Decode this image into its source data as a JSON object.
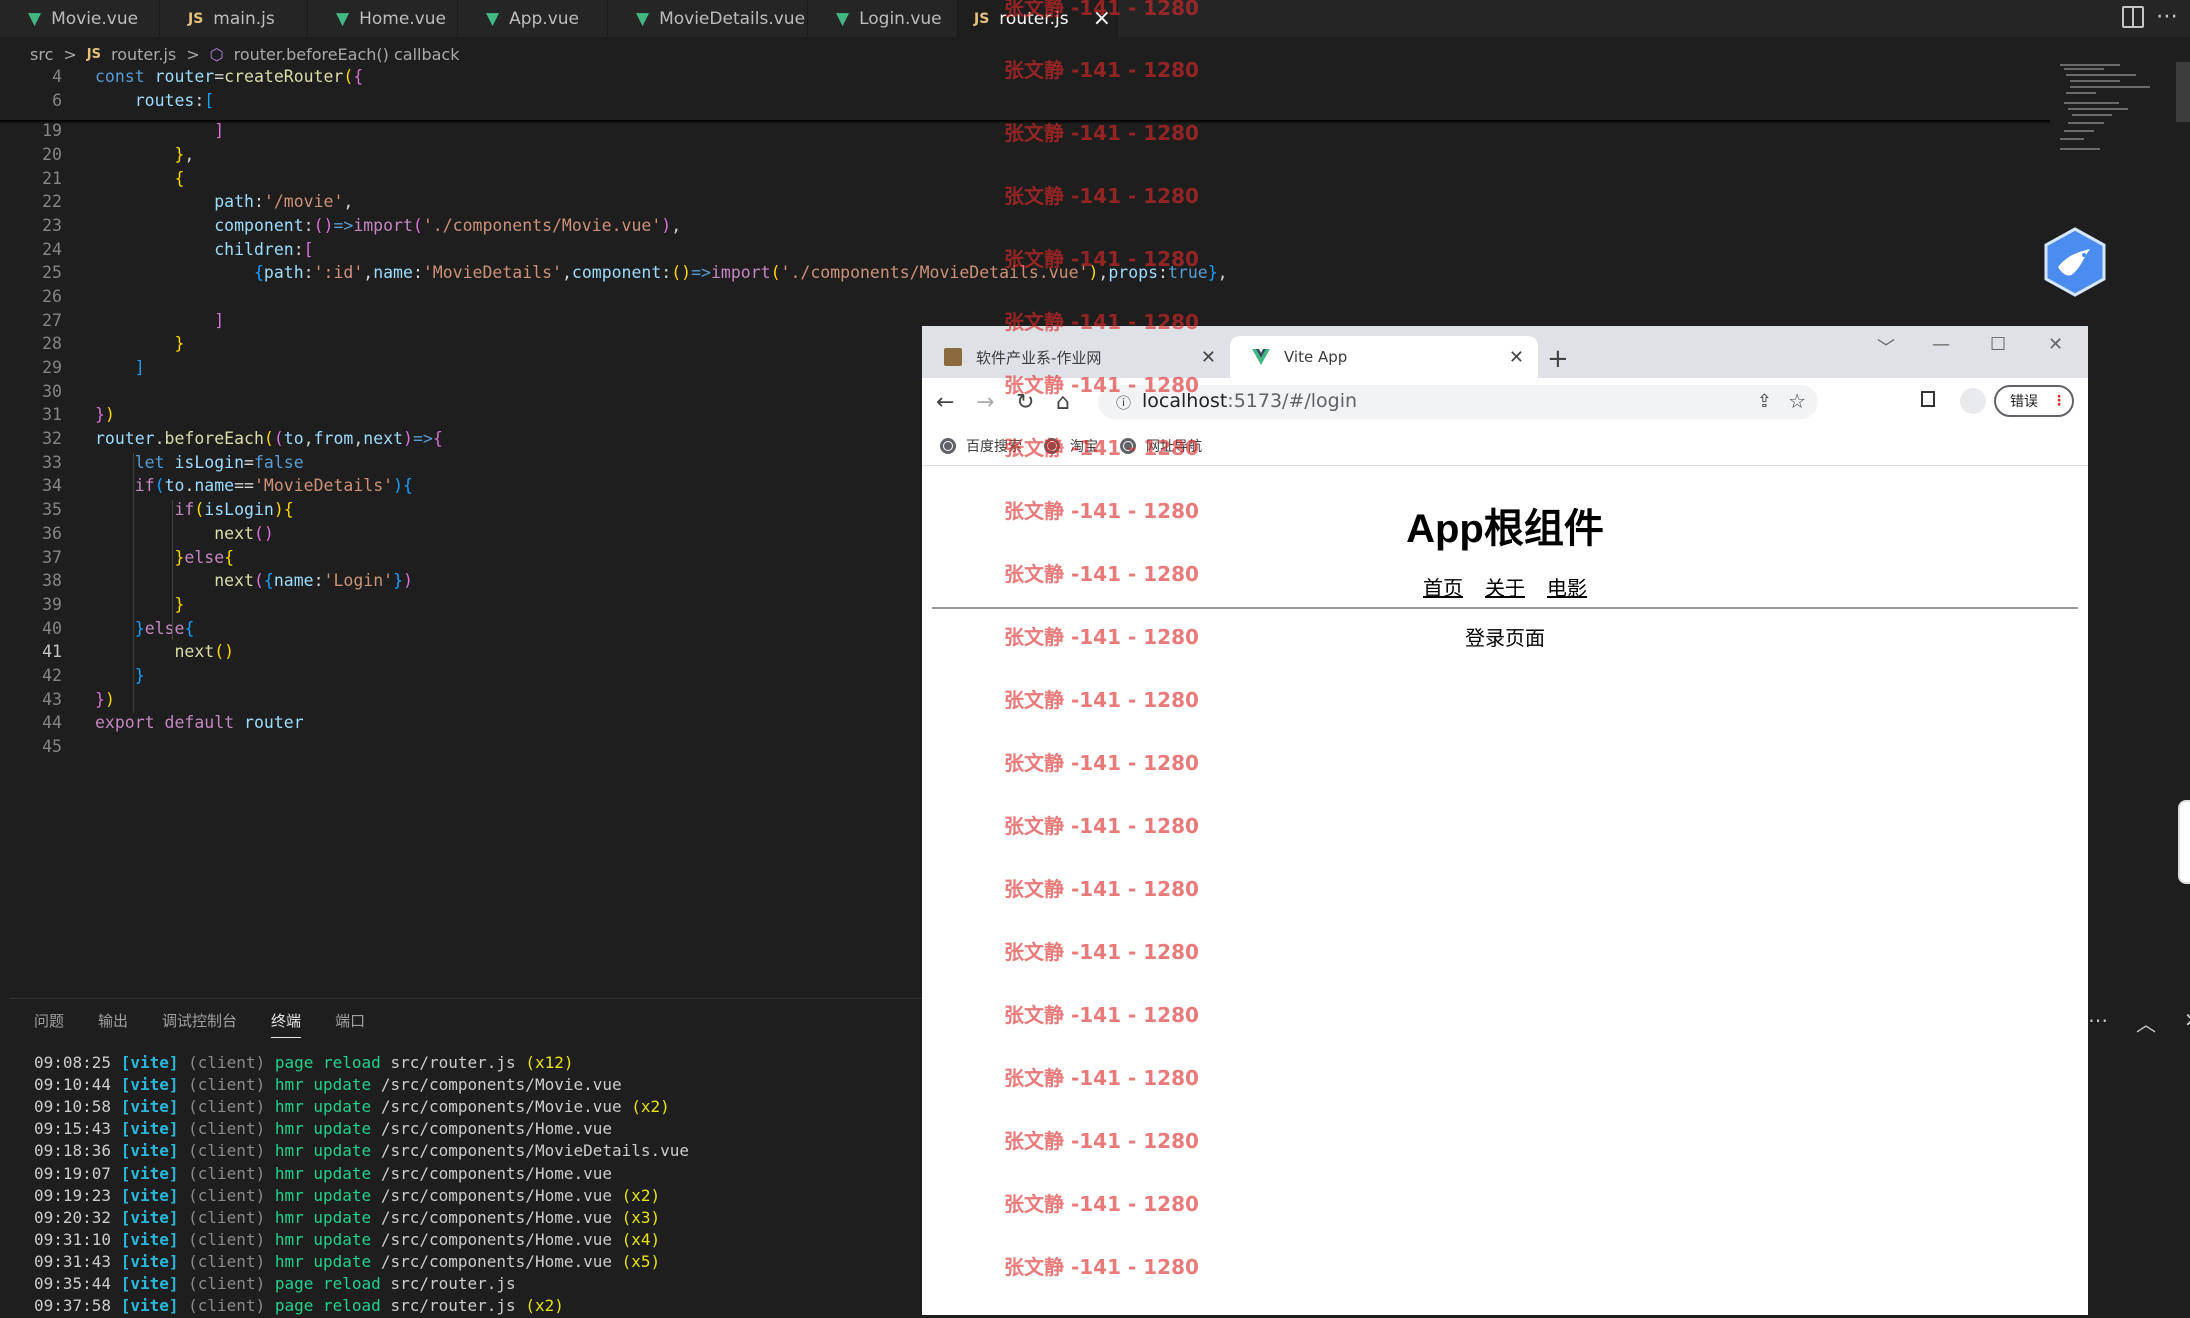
{
  "editor": {
    "tabs": [
      {
        "label": "Movie.vue",
        "type": "vue"
      },
      {
        "label": "main.js",
        "type": "js"
      },
      {
        "label": "Home.vue",
        "type": "vue"
      },
      {
        "label": "App.vue",
        "type": "vue"
      },
      {
        "label": "MovieDetails.vue",
        "type": "vue"
      },
      {
        "label": "Login.vue",
        "type": "vue"
      },
      {
        "label": "router.js",
        "type": "js",
        "active": true
      }
    ],
    "js_badge": "JS",
    "close_glyph": "×",
    "breadcrumb": {
      "folder": "src",
      "sep": ">",
      "file": "router.js",
      "symbol": "router.beforeEach() callback"
    },
    "line_numbers": [
      "4",
      "6",
      "19",
      "20",
      "21",
      "22",
      "23",
      "24",
      "25",
      "26",
      "27",
      "28",
      "29",
      "30",
      "31",
      "32",
      "33",
      "34",
      "35",
      "36",
      "37",
      "38",
      "39",
      "40",
      "41",
      "42",
      "43",
      "44",
      "45"
    ]
  },
  "panel": {
    "tabs": [
      "问题",
      "输出",
      "调试控制台",
      "终端",
      "端口"
    ],
    "active_tab": "终端",
    "terminal": [
      {
        "time": "09:08:25",
        "tag": "[vite]",
        "src": "(client)",
        "action": "page reload",
        "path": "src/router.js",
        "count": "(x12)"
      },
      {
        "time": "09:10:44",
        "tag": "[vite]",
        "src": "(client)",
        "action": "hmr update",
        "path": "/src/components/Movie.vue",
        "count": ""
      },
      {
        "time": "09:10:58",
        "tag": "[vite]",
        "src": "(client)",
        "action": "hmr update",
        "path": "/src/components/Movie.vue",
        "count": "(x2)"
      },
      {
        "time": "09:15:43",
        "tag": "[vite]",
        "src": "(client)",
        "action": "hmr update",
        "path": "/src/components/Home.vue",
        "count": ""
      },
      {
        "time": "09:18:36",
        "tag": "[vite]",
        "src": "(client)",
        "action": "hmr update",
        "path": "/src/components/MovieDetails.vue",
        "count": ""
      },
      {
        "time": "09:19:07",
        "tag": "[vite]",
        "src": "(client)",
        "action": "hmr update",
        "path": "/src/components/Home.vue",
        "count": ""
      },
      {
        "time": "09:19:23",
        "tag": "[vite]",
        "src": "(client)",
        "action": "hmr update",
        "path": "/src/components/Home.vue",
        "count": "(x2)"
      },
      {
        "time": "09:20:32",
        "tag": "[vite]",
        "src": "(client)",
        "action": "hmr update",
        "path": "/src/components/Home.vue",
        "count": "(x3)"
      },
      {
        "time": "09:31:10",
        "tag": "[vite]",
        "src": "(client)",
        "action": "hmr update",
        "path": "/src/components/Home.vue",
        "count": "(x4)"
      },
      {
        "time": "09:31:43",
        "tag": "[vite]",
        "src": "(client)",
        "action": "hmr update",
        "path": "/src/components/Home.vue",
        "count": "(x5)"
      },
      {
        "time": "09:35:44",
        "tag": "[vite]",
        "src": "(client)",
        "action": "page reload",
        "path": "src/router.js",
        "count": ""
      },
      {
        "time": "09:37:58",
        "tag": "[vite]",
        "src": "(client)",
        "action": "page reload",
        "path": "src/router.js",
        "count": "(x2)"
      }
    ]
  },
  "browser": {
    "tabs": [
      {
        "label": "软件产业系-作业网",
        "active": false
      },
      {
        "label": "Vite App",
        "active": true
      }
    ],
    "url_host": "localhost",
    "url_rest": ":5173/#/login",
    "error_button": "错误",
    "bookmarks": [
      "百度搜索",
      "淘宝",
      "网址导航"
    ],
    "page": {
      "title": "App根组件",
      "nav": [
        "首页",
        "关于",
        "电影"
      ],
      "content": "登录页面"
    }
  },
  "watermark": "张文静 -141 - 1280",
  "colors": {
    "editor_bg": "#1e1e1e",
    "vue_green": "#41b883",
    "watermark": "#dc2828"
  }
}
